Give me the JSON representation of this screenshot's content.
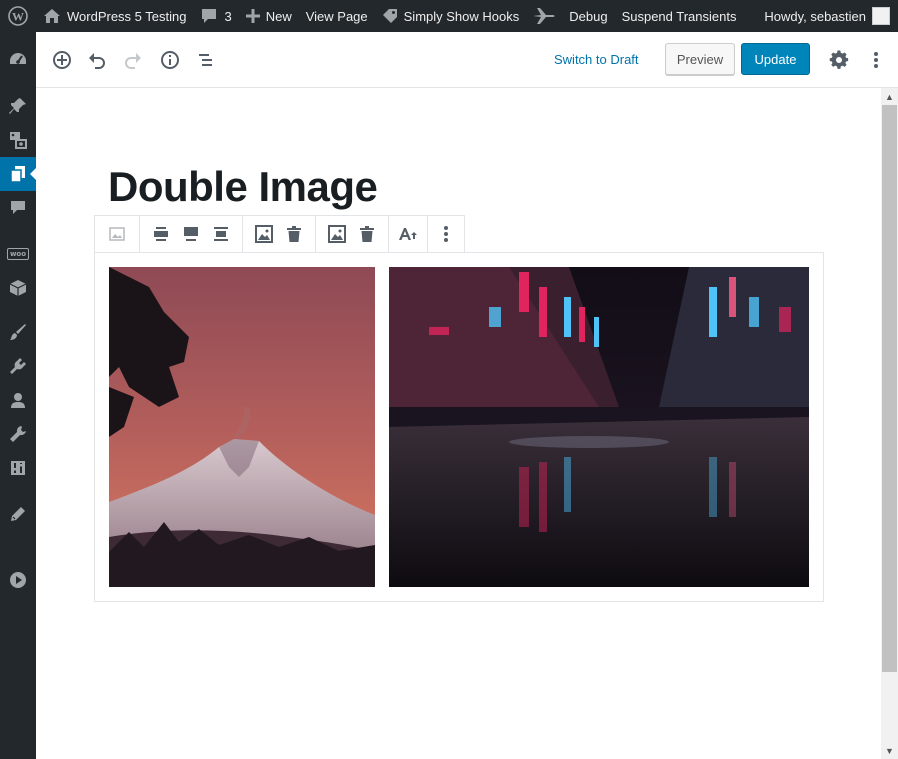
{
  "adminbar": {
    "site_name": "WordPress 5 Testing",
    "comments_count": "3",
    "new_label": "New",
    "view_page_label": "View Page",
    "hooks_label": "Simply Show Hooks",
    "debug_label": "Debug",
    "transients_label": "Suspend Transients",
    "howdy_label": "Howdy, sebastien"
  },
  "sidebar": {
    "items": [
      "dashboard-icon",
      "posts-icon",
      "media-icon",
      "pages-icon",
      "comments-icon",
      "woocommerce-icon",
      "products-icon",
      "appearance-icon",
      "plugins-icon",
      "users-icon",
      "tools-icon",
      "settings-icon",
      "edit-icon",
      "play-icon"
    ],
    "woo_label": "woo",
    "active_item": "pages-icon"
  },
  "header": {
    "switch_to_draft": "Switch to Draft",
    "preview_label": "Preview",
    "update_label": "Update"
  },
  "editor": {
    "title": "Double Image"
  },
  "colors": {
    "accent": "#0085ba",
    "link": "#0073aa",
    "adminbar": "#23282d"
  }
}
